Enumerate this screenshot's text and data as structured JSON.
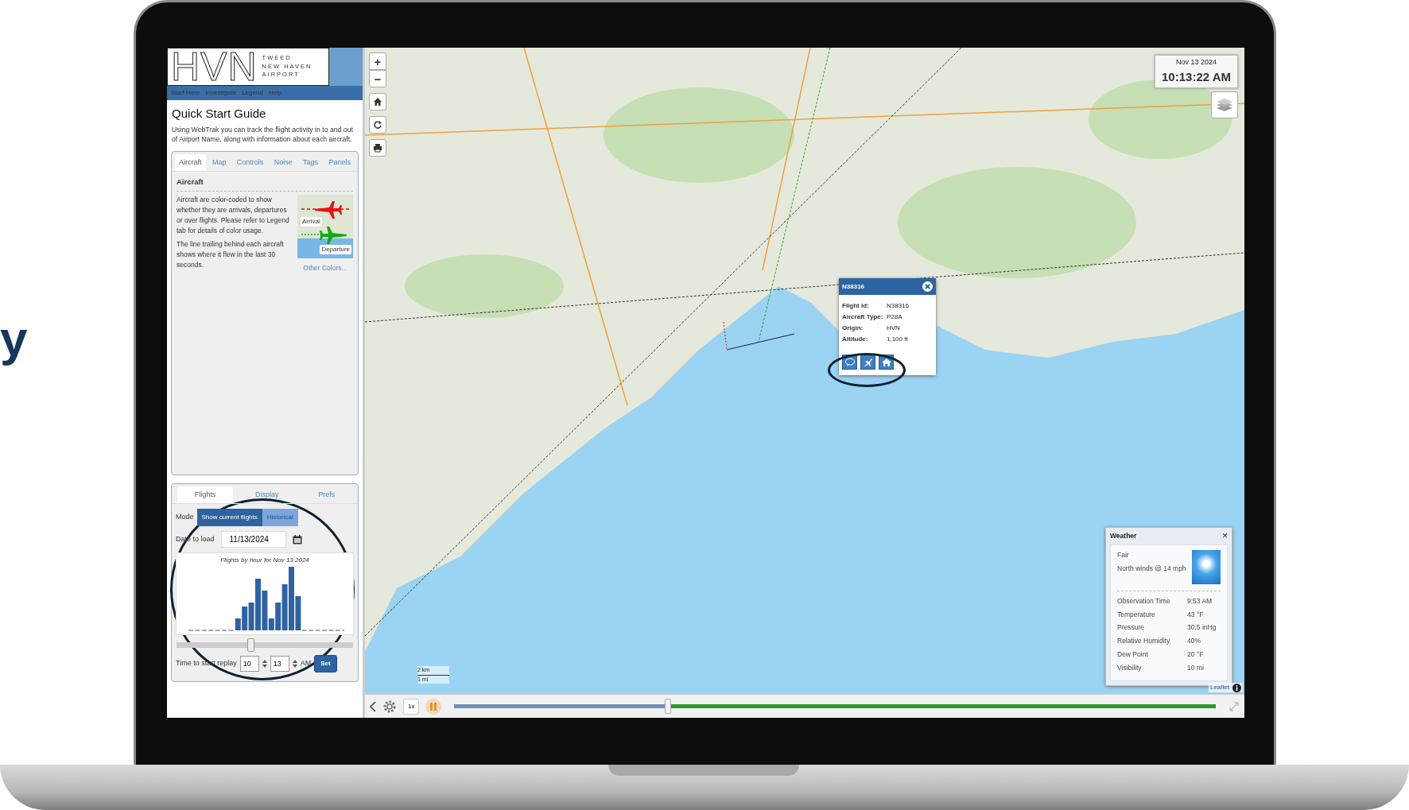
{
  "side_text": "y",
  "header": {
    "logo": "HVN",
    "logo_lines": [
      "TWEED",
      "NEW HAVEN",
      "AIRPORT"
    ]
  },
  "nav": [
    {
      "label": "Start Here"
    },
    {
      "label": "Investigate"
    },
    {
      "label": "Legend"
    },
    {
      "label": "Help"
    }
  ],
  "guide": {
    "title": "Quick Start Guide",
    "intro": "Using WebTrak you can track the flight activity in to and out of Airport Name, along with information about each aircraft."
  },
  "guide_tabs": [
    {
      "label": "Aircraft",
      "selected": true
    },
    {
      "label": "Map",
      "selected": false
    },
    {
      "label": "Controls",
      "selected": false
    },
    {
      "label": "Noise",
      "selected": false
    },
    {
      "label": "Tags",
      "selected": false
    },
    {
      "label": "Panels",
      "selected": false
    }
  ],
  "aircraft": {
    "heading": "Aircraft",
    "paragraphs": [
      "Aircraft are color-coded to show whether they are arrivals, departures or over flights. Please refer to Legend tab for details of color usage.",
      "The line trailing behind each aircraft shows where it flew in the last 30 seconds."
    ],
    "image_labels": [
      "Arrival",
      "Departure"
    ],
    "link": "Other Colors..."
  },
  "control_tabs": [
    {
      "label": "Flights",
      "selected": true
    },
    {
      "label": "Display",
      "selected": false
    },
    {
      "label": "Prefs",
      "selected": false
    }
  ],
  "mode": {
    "label": "Mode",
    "options": [
      {
        "label": "Show current flights",
        "selected": true
      },
      {
        "label": "Historical",
        "selected": false
      }
    ]
  },
  "date": {
    "label": "Date to load",
    "value": "11/13/2024"
  },
  "chart_title": "Flights by hour for Nov 13 2024",
  "replay_slider": {
    "level": 0.42
  },
  "replay": {
    "label": "Time to start replay",
    "hour": "10",
    "minute": "13",
    "ampm": "AM",
    "button": "Set"
  },
  "zoom": [
    "+",
    "−"
  ],
  "clock": {
    "date": "Nov 13 2024",
    "time": "10:13:22 AM"
  },
  "popup": {
    "title": "N38316",
    "fields": [
      {
        "label": "Flight Id:",
        "value": "N38316"
      },
      {
        "label": "Aircraft Type:",
        "value": "P28A"
      },
      {
        "label": "Origin:",
        "value": "HVN"
      },
      {
        "label": "Altitude:",
        "value": "1,100 ft"
      }
    ]
  },
  "scale": [
    "2 km",
    "1 mi"
  ],
  "weather": {
    "title": "Weather",
    "close": "×",
    "condition": "Fair",
    "wind": "North winds @ 14 mph",
    "rows": [
      {
        "label": "Observation Time",
        "value": "9:53 AM"
      },
      {
        "label": "Temperature",
        "value": "43 °F"
      },
      {
        "label": "Pressure",
        "value": "30.5 inHg"
      },
      {
        "label": "Relative Humidity",
        "value": "40%"
      },
      {
        "label": "Dew Point",
        "value": "20 °F"
      },
      {
        "label": "Visibility",
        "value": "10 mi"
      }
    ]
  },
  "attribution": "Leaflet",
  "playback": {
    "speed": "1x",
    "level": 0.28
  }
}
